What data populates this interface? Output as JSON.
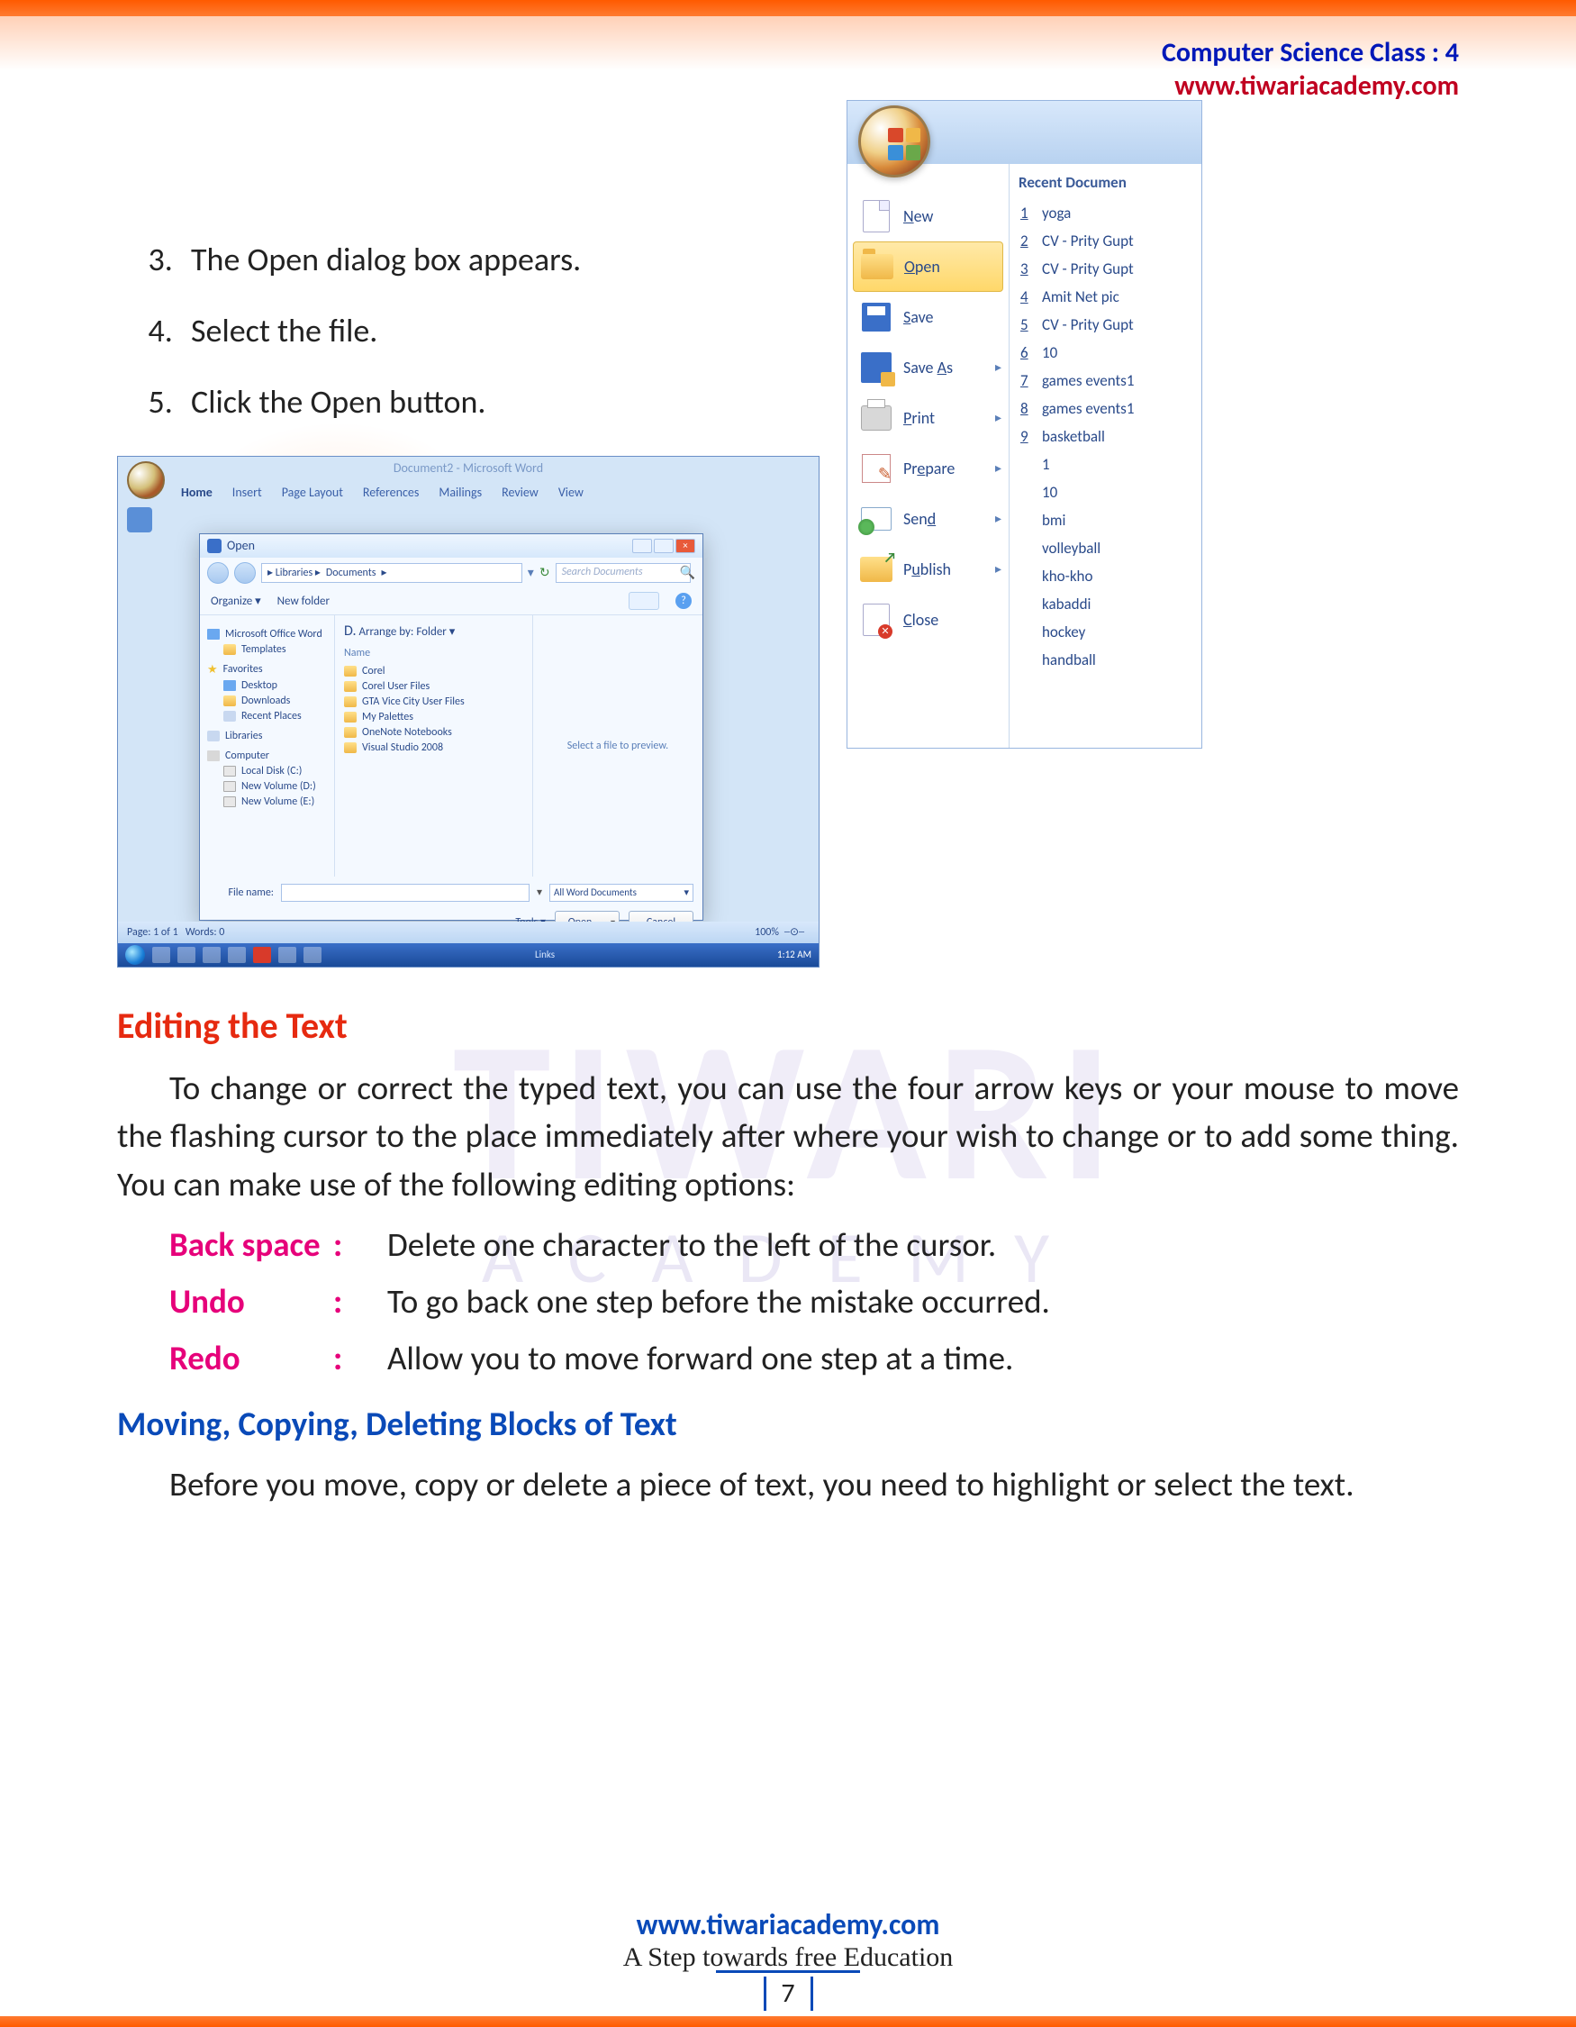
{
  "header": {
    "line1": "Computer Science Class : 4",
    "line2": "www.tiwariacademy.com"
  },
  "steps": [
    "The Open dialog box appears.",
    "Select the file.",
    "Click the Open button."
  ],
  "word": {
    "title": "Document2 - Microsoft Word",
    "tabs": [
      "Home",
      "Insert",
      "Page Layout",
      "References",
      "Mailings",
      "Review",
      "View"
    ],
    "dialog": {
      "title": "Open",
      "path": [
        "Libraries",
        "Documents"
      ],
      "search_placeholder": "Search Documents",
      "organize": "Organize ▾",
      "newfolder": "New folder",
      "side": {
        "word": "Microsoft Office Word",
        "templates": "Templates",
        "fav": "Favorites",
        "desktop": "Desktop",
        "downloads": "Downloads",
        "recent": "Recent Places",
        "libraries": "Libraries",
        "computer": "Computer",
        "c": "Local Disk (C:)",
        "d": "New Volume (D:)",
        "e": "New Volume (E:)"
      },
      "arrange_label": "Arrange by:",
      "arrange_value": "Folder ▾",
      "d_label": "D.",
      "name_head": "Name",
      "folders": [
        "Corel",
        "Corel User Files",
        "GTA Vice City User Files",
        "My Palettes",
        "OneNote Notebooks",
        "Visual Studio 2008"
      ],
      "preview": "Select a file to preview.",
      "filename_label": "File name:",
      "filetype": "All Word Documents",
      "tools": "Tools  ▾",
      "open": "Open",
      "cancel": "Cancel"
    },
    "status": {
      "page": "Page: 1 of 1",
      "words": "Words: 0",
      "zoom": "100%"
    },
    "taskbar": {
      "links": "Links",
      "time": "1:12 AM"
    }
  },
  "menu": {
    "recent_head": "Recent Documen",
    "left": [
      {
        "key": "N",
        "label": "ew",
        "icon": "new",
        "arrow": false
      },
      {
        "key": "O",
        "label": "pen",
        "icon": "open",
        "arrow": false,
        "sel": true
      },
      {
        "key": "S",
        "label": "ave",
        "icon": "save",
        "arrow": false
      },
      {
        "key": "A",
        "label": "Save ",
        "post": "s",
        "icon": "saveas",
        "arrow": true
      },
      {
        "key": "P",
        "label": "rint",
        "icon": "print",
        "arrow": true
      },
      {
        "key": "E",
        "label": "Pr",
        "post": "pare",
        "icon": "prepare",
        "arrow": true
      },
      {
        "key": "D",
        "label": "Sen",
        "post": "",
        "icon": "send",
        "arrow": true
      },
      {
        "key": "U",
        "label": "P",
        "post": "blish",
        "icon": "publish",
        "arrow": true
      },
      {
        "key": "C",
        "label": "lose",
        "icon": "close",
        "arrow": false
      }
    ],
    "recent": [
      {
        "n": "1",
        "t": "yoga"
      },
      {
        "n": "2",
        "t": "CV - Prity Gupt"
      },
      {
        "n": "3",
        "t": "CV - Prity Gupt"
      },
      {
        "n": "4",
        "t": "Amit Net pic"
      },
      {
        "n": "5",
        "t": "CV - Prity Gupt"
      },
      {
        "n": "6",
        "t": "10"
      },
      {
        "n": "7",
        "t": "games events1"
      },
      {
        "n": "8",
        "t": "games events1"
      },
      {
        "n": "9",
        "t": "basketball"
      },
      {
        "n": "",
        "t": "1"
      },
      {
        "n": "",
        "t": "10"
      },
      {
        "n": "",
        "t": "bmi"
      },
      {
        "n": "",
        "t": "volleyball"
      },
      {
        "n": "",
        "t": "kho-kho"
      },
      {
        "n": "",
        "t": "kabaddi"
      },
      {
        "n": "",
        "t": "hockey"
      },
      {
        "n": "",
        "t": "handball"
      }
    ]
  },
  "body": {
    "h_editing": "Editing the Text",
    "p_editing": "To change or correct the typed text, you can use the four arrow keys or your mouse to move the flashing cursor to the place immediately after where your wish to change or to add some thing. You can make use of the following editing options:",
    "opts": [
      {
        "k": "Back space",
        "d": "Delete one character to the left of the cursor."
      },
      {
        "k": "Undo",
        "d": "To go back one step before the mistake occurred."
      },
      {
        "k": "Redo",
        "d": "Allow you to move forward one step at a time."
      }
    ],
    "h_moving": "Moving, Copying, Deleting Blocks of Text",
    "p_moving": "Before you move, copy or delete a piece of text, you need to highlight or select the text."
  },
  "watermark": {
    "big": "TIWARI",
    "small": "ACADEMY"
  },
  "footer": {
    "link": "www.tiwariacademy.com",
    "sub": "A Step towards free Education",
    "page": "7"
  }
}
